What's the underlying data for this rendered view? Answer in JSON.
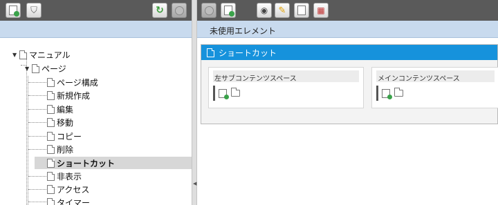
{
  "left_toolbar": {
    "add_page_icon": "page-add-icon",
    "filter_icon": "filter-icon",
    "refresh_icon": "refresh-icon",
    "disabled_icon": "circle-icon"
  },
  "right_toolbar": {
    "icons": [
      "circle-icon",
      "page-add-icon",
      "preview-icon",
      "edit-icon",
      "page-insert-icon",
      "calendar-icon"
    ]
  },
  "right_header": {
    "title": "未使用エレメント"
  },
  "tree": {
    "root": "マニュアル",
    "page": "ページ",
    "items": [
      "ページ構成",
      "新規作成",
      "編集",
      "移動",
      "コピー",
      "削除",
      "ショートカット",
      "非表示",
      "アクセス",
      "タイマー"
    ],
    "selected": "ショートカット"
  },
  "panel": {
    "title": "ショートカット",
    "left_box_title": "左サブコンテンツスペース",
    "main_box_title": "メインコンテンツスペース"
  },
  "colors": {
    "toolbar": "#5a5a5a",
    "header": "#c8daee",
    "panel_head": "#1692dc"
  }
}
